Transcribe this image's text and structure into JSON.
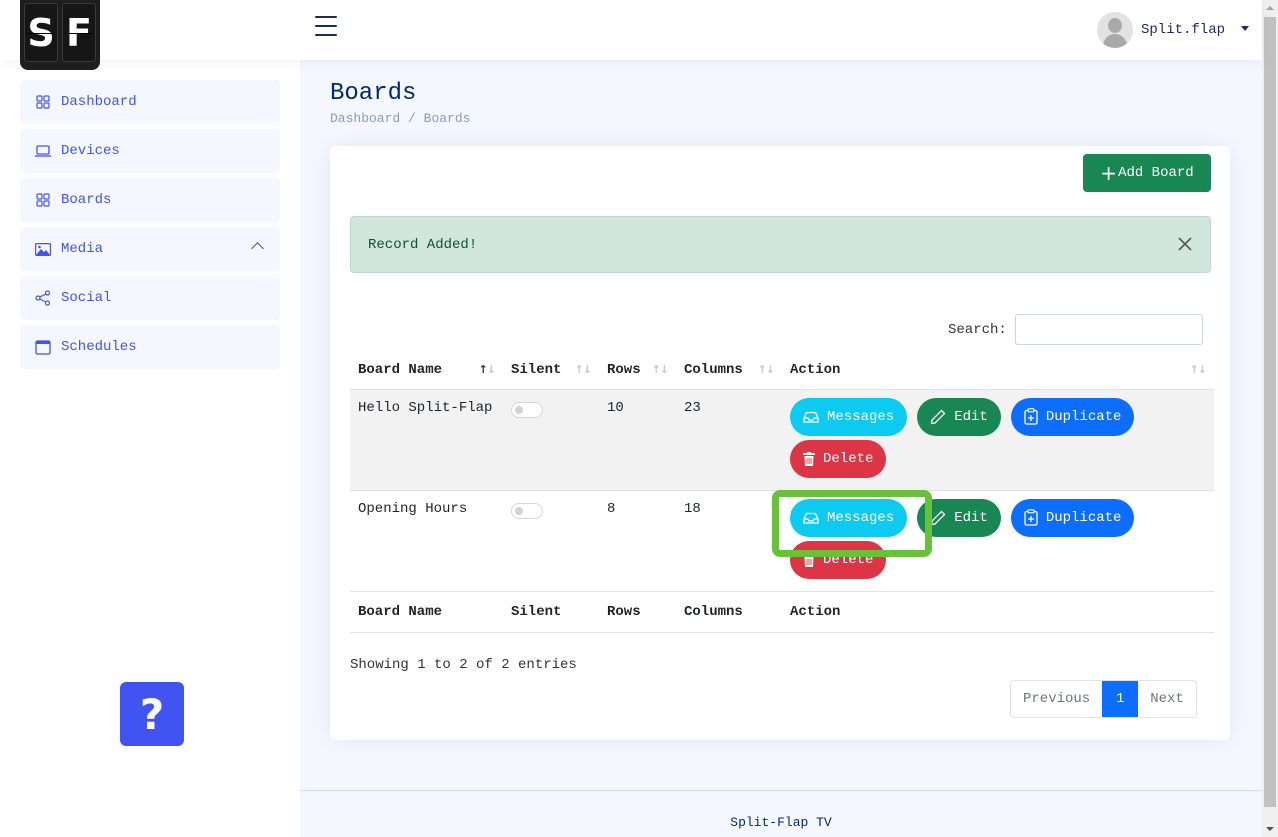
{
  "logo": {
    "letters": [
      "S",
      "F"
    ]
  },
  "header": {
    "username": "Split.flap"
  },
  "sidebar": {
    "items": [
      {
        "label": "Dashboard",
        "icon": "grid-icon"
      },
      {
        "label": "Devices",
        "icon": "laptop-icon"
      },
      {
        "label": "Boards",
        "icon": "grid-icon"
      },
      {
        "label": "Media",
        "icon": "image-icon",
        "expanded": true
      },
      {
        "label": "Social",
        "icon": "share-icon"
      },
      {
        "label": "Schedules",
        "icon": "calendar-icon"
      }
    ],
    "help_label": "?"
  },
  "page": {
    "title": "Boards",
    "breadcrumb": [
      "Dashboard",
      "Boards"
    ],
    "breadcrumb_sep": "/"
  },
  "toolbar": {
    "add_label": "Add Board",
    "add_icon": "+"
  },
  "alert": {
    "message": "Record Added!",
    "color": "#d1e7dd"
  },
  "search": {
    "label": "Search:",
    "value": "",
    "placeholder": ""
  },
  "table": {
    "columns": [
      "Board Name",
      "Silent",
      "Rows",
      "Columns",
      "Action"
    ],
    "rows": [
      {
        "name": "Hello Split-Flap",
        "silent": false,
        "rows": "10",
        "columns": "23"
      },
      {
        "name": "Opening Hours",
        "silent": false,
        "rows": "8",
        "columns": "18"
      }
    ],
    "actions": {
      "messages": "Messages",
      "edit": "Edit",
      "duplicate": "Duplicate",
      "delete": "Delete"
    },
    "sort_glyph": "↑↓"
  },
  "pagination": {
    "info": "Showing 1 to 2 of 2 entries",
    "previous": "Previous",
    "current": "1",
    "next": "Next"
  },
  "footer": {
    "text": "Split-Flap TV"
  },
  "colors": {
    "brand": "#4154f1",
    "info": "#0dcaf0",
    "success": "#198754",
    "primary": "#0d6efd",
    "danger": "#dc3545",
    "highlight": "#67c23a"
  }
}
